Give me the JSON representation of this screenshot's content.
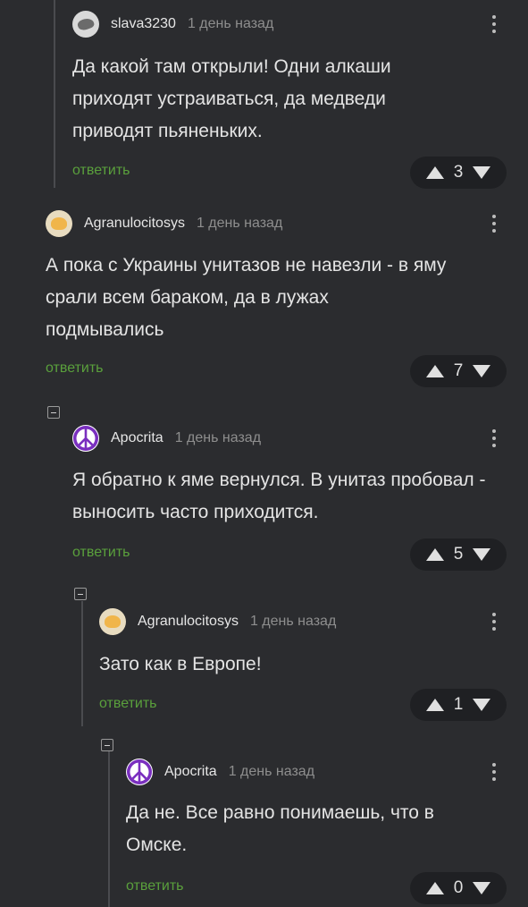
{
  "reply_label": "ответить",
  "comments": [
    {
      "username": "slava3230",
      "time": "1 день назад",
      "text": "Да какой там открыли! Одни алкаши приходят устраиваться, да медведи приводят пьяненьких.",
      "votes": "3"
    },
    {
      "username": "Agranulocitosys",
      "time": "1 день назад",
      "text": "А пока с Украины унитазов не навезли - в яму срали всем бараком, да в лужах подмывались",
      "votes": "7"
    },
    {
      "username": "Apocrita",
      "time": "1 день назад",
      "text": "Я обратно к яме вернулся. В унитаз пробовал - выносить часто приходится.",
      "votes": "5"
    },
    {
      "username": "Agranulocitosys",
      "time": "1 день назад",
      "text": "Зато как в Европе!",
      "votes": "1"
    },
    {
      "username": "Apocrita",
      "time": "1 день назад",
      "text": "Да не. Все равно понимаешь, что в Омске.",
      "votes": "0"
    }
  ]
}
